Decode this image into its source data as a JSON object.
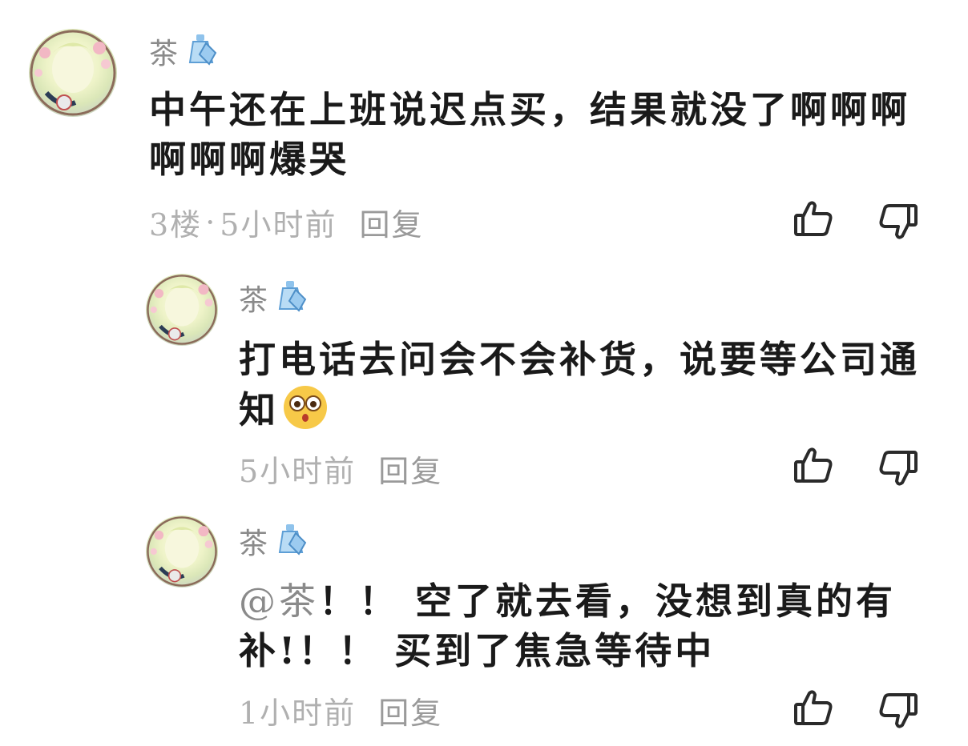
{
  "comments": [
    {
      "username": "茶",
      "badge_icon": "bottle-badge-icon",
      "content": "中午还在上班说迟点买，结果就没了啊啊啊啊啊啊爆哭",
      "floor": "3楼",
      "separator": "·",
      "time": "5小时前",
      "reply_label": "回复"
    },
    {
      "username": "茶",
      "badge_icon": "bottle-badge-icon",
      "content": "打电话去问会不会补货，说要等公司通知",
      "emoji": "teary-eyes-emoji",
      "time": "5小时前",
      "reply_label": "回复"
    },
    {
      "username": "茶",
      "badge_icon": "bottle-badge-icon",
      "mention": "@茶",
      "content": "！！ 空了就去看，没想到真的有补!！！ 买到了焦急等待中",
      "time": "1小时前",
      "reply_label": "回复"
    }
  ],
  "icons": {
    "like": "thumbs-up-icon",
    "dislike": "thumbs-down-icon"
  },
  "colors": {
    "text": "#1a1a1a",
    "meta": "#b0b0b0",
    "username": "#8a8a8a",
    "badge": "#6fa8dc"
  }
}
